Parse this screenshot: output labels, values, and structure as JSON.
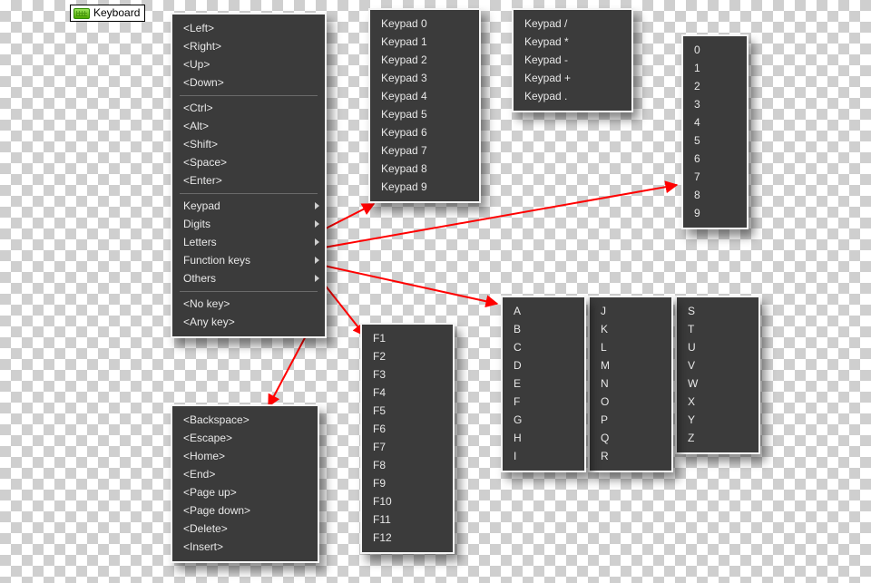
{
  "chip": {
    "label": "Keyboard"
  },
  "main_menu": {
    "group1": [
      "<Left>",
      "<Right>",
      "<Up>",
      "<Down>"
    ],
    "group2": [
      "<Ctrl>",
      "<Alt>",
      "<Shift>",
      "<Space>",
      "<Enter>"
    ],
    "subs": [
      "Keypad",
      "Digits",
      "Letters",
      "Function keys",
      "Others"
    ],
    "group3": [
      "<No key>",
      "<Any key>"
    ]
  },
  "keypad": {
    "nums": [
      "Keypad 0",
      "Keypad 1",
      "Keypad 2",
      "Keypad 3",
      "Keypad 4",
      "Keypad 5",
      "Keypad 6",
      "Keypad 7",
      "Keypad 8",
      "Keypad 9"
    ],
    "ops": [
      "Keypad /",
      "Keypad *",
      "Keypad -",
      "Keypad +",
      "Keypad ."
    ]
  },
  "digits": [
    "0",
    "1",
    "2",
    "3",
    "4",
    "5",
    "6",
    "7",
    "8",
    "9"
  ],
  "fkeys": [
    "F1",
    "F2",
    "F3",
    "F4",
    "F5",
    "F6",
    "F7",
    "F8",
    "F9",
    "F10",
    "F11",
    "F12"
  ],
  "letters": {
    "col1": [
      "A",
      "B",
      "C",
      "D",
      "E",
      "F",
      "G",
      "H",
      "I"
    ],
    "col2": [
      "J",
      "K",
      "L",
      "M",
      "N",
      "O",
      "P",
      "Q",
      "R"
    ],
    "col3": [
      "S",
      "T",
      "U",
      "V",
      "W",
      "X",
      "Y",
      "Z"
    ]
  },
  "others": [
    "<Backspace>",
    "<Escape>",
    "<Home>",
    "<End>",
    "<Page up>",
    "<Page down>",
    "<Delete>",
    "<Insert>"
  ]
}
